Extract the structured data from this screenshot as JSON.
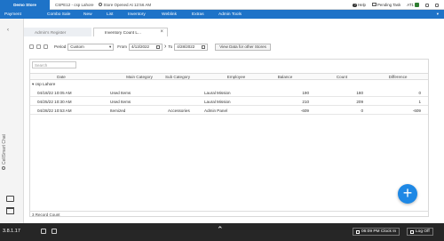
{
  "topbar": {
    "store_name": "Demo Store",
    "store_info": "CSPE12 - csp Lahore",
    "store_status": "Store Opened At 12:56 AM",
    "help": "Help",
    "pending_task": "Pending Task",
    "user_short": "AT1"
  },
  "nav": [
    "Payment",
    "Combo Sale",
    "New",
    "List",
    "Inventory",
    "Weblink",
    "Extras",
    "Admin Tools"
  ],
  "rail": {
    "chat_label": "CellSmart Chat"
  },
  "tabs": [
    {
      "label": "Admin's Register"
    },
    {
      "label": "Inventory Count L..."
    }
  ],
  "toolbar": {
    "period_label": "Period",
    "period_value": "Custom",
    "from_label": "From",
    "from_date": "4/13/2022",
    "to_label": "To",
    "to_date": "4/28/2022",
    "view_button": "View Data for other Stores"
  },
  "grid": {
    "search_placeholder": "Search",
    "columns": [
      "Date",
      "Main Category",
      "Sub Category",
      "Employee",
      "Balance",
      "Count",
      "Difference"
    ],
    "group_label": "csp Lahore",
    "rows": [
      {
        "date": "04/18/22 10:05 AM",
        "main": "Used Items",
        "sub": "",
        "employee": "Laural Mission",
        "balance": "190",
        "count": "180",
        "diff": "0"
      },
      {
        "date": "04/25/22 10:30 AM",
        "main": "Used Items",
        "sub": "",
        "employee": "Laural Mission",
        "balance": "210",
        "count": "209",
        "diff": "1"
      },
      {
        "date": "04/28/22 10:53 AM",
        "main": "Itemized",
        "sub": "Accessories",
        "employee": "Admin Panel",
        "balance": "-609",
        "count": "0",
        "diff": "-609"
      }
    ],
    "footer": "3 Record Count"
  },
  "bottombar": {
    "version": "3.8.1.17",
    "clock_in": "06:09 PM Clock In",
    "logoff": "Log Off"
  },
  "colors": {
    "brand": "#1e73c8",
    "fab": "#1e88e5",
    "bottom": "#262626"
  }
}
